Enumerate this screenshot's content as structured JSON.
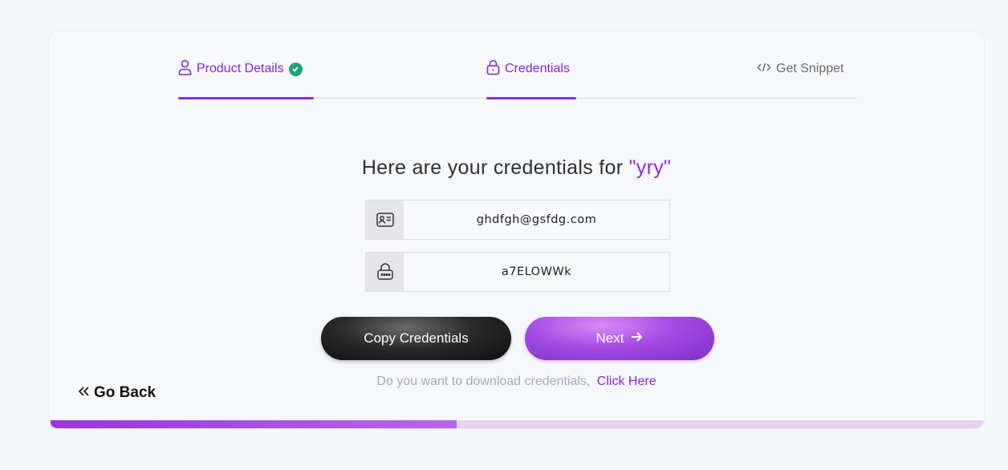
{
  "steps": [
    {
      "label": "Product Details",
      "state": "completed",
      "icon": "user-icon"
    },
    {
      "label": "Credentials",
      "state": "active",
      "icon": "lock-icon"
    },
    {
      "label": "Get Snippet",
      "state": "pending",
      "icon": "code-icon"
    }
  ],
  "heading": {
    "prefix": "Here are your credentials for ",
    "product": "\"yry\""
  },
  "credentials": {
    "email_icon": "id-card-icon",
    "email": "ghdfgh@gsfdg.com",
    "password_icon": "lock-icon",
    "password": "a7ELOWWk"
  },
  "buttons": {
    "copy_label": "Copy Credentials",
    "next_label": "Next"
  },
  "download": {
    "text": "Do you want to download credentials,",
    "link": "Click Here"
  },
  "go_back": "Go Back",
  "progress": {
    "fraction": 0.435
  },
  "colors": {
    "accent": "#8228d0",
    "success": "#1fa37a",
    "progress_track": "#e6d2f2"
  }
}
